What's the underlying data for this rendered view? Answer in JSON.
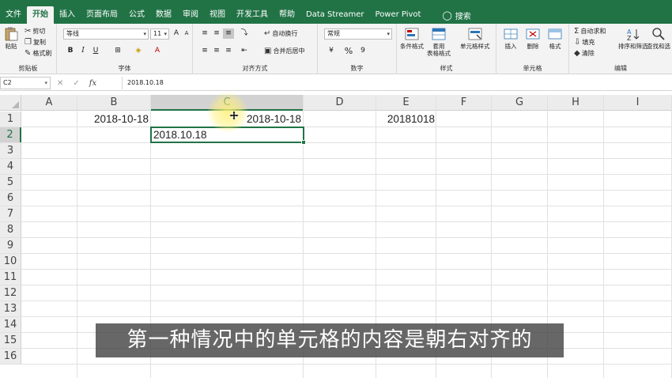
{
  "ribbon_tabs": [
    "文件",
    "开始",
    "插入",
    "页面布局",
    "公式",
    "数据",
    "审阅",
    "视图",
    "开发工具",
    "帮助",
    "Data Streamer",
    "Power Pivot"
  ],
  "search_label": "搜索",
  "clipboard": {
    "label": "剪贴板",
    "paste": "粘贴",
    "cut": "剪切",
    "copy": "复制",
    "format_painter": "格式刷"
  },
  "font": {
    "label": "字体",
    "name": "等线",
    "size": "11",
    "bold": "B",
    "italic": "I",
    "underline": "U",
    "grow": "A",
    "shrink": "A"
  },
  "alignment": {
    "label": "对齐方式",
    "wrap": "自动换行",
    "merge": "合并后居中"
  },
  "number": {
    "label": "数字",
    "format": "常规",
    "percent": "%",
    "comma": "9"
  },
  "styles": {
    "label": "样式",
    "conditional": "条件格式",
    "table_line1": "套用",
    "table_line2": "表格格式",
    "cell_styles": "单元格样式"
  },
  "cells": {
    "label": "单元格",
    "insert": "插入",
    "delete": "删除",
    "format": "格式"
  },
  "editing": {
    "label": "编辑",
    "autosum": "自动求和",
    "fill": "填充",
    "clear": "清除",
    "sort": "排序和筛选",
    "find": "查找和选"
  },
  "formula_bar": {
    "name_box": "C2",
    "content": "2018.10.18"
  },
  "columns": [
    "A",
    "B",
    "C",
    "D",
    "E",
    "F",
    "G",
    "H",
    "I"
  ],
  "rows": [
    "1",
    "2",
    "3",
    "4",
    "5",
    "6",
    "7",
    "8",
    "9",
    "10",
    "11",
    "12",
    "13",
    "14",
    "15",
    "16"
  ],
  "cells_data": {
    "B1": "2018-10-18",
    "C1": "2018-10-18",
    "E1": "20181018",
    "C2": "2018.10.18"
  },
  "subtitle": "第一种情况中的单元格的内容是朝右对齐的",
  "colors": {
    "accent": "#217346"
  }
}
